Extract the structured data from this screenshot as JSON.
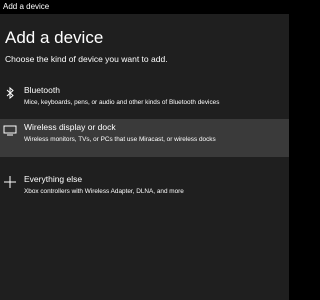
{
  "window": {
    "title": "Add a device"
  },
  "dialog": {
    "heading": "Add a device",
    "subheading": "Choose the kind of device you want to add."
  },
  "options": [
    {
      "icon": "bluetooth-icon",
      "title": "Bluetooth",
      "description": "Mice, keyboards, pens, or audio and other kinds of Bluetooth devices",
      "selected": false
    },
    {
      "icon": "monitor-icon",
      "title": "Wireless display or dock",
      "description": "Wireless monitors, TVs, or PCs that use Miracast, or wireless docks",
      "selected": true
    },
    {
      "icon": "plus-icon",
      "title": "Everything else",
      "description": "Xbox controllers with Wireless Adapter, DLNA, and more",
      "selected": false
    }
  ],
  "colors": {
    "background": "#1f1f1f",
    "title_bar": "#000000",
    "selected_row": "#3a3a3a",
    "text": "#ffffff"
  }
}
